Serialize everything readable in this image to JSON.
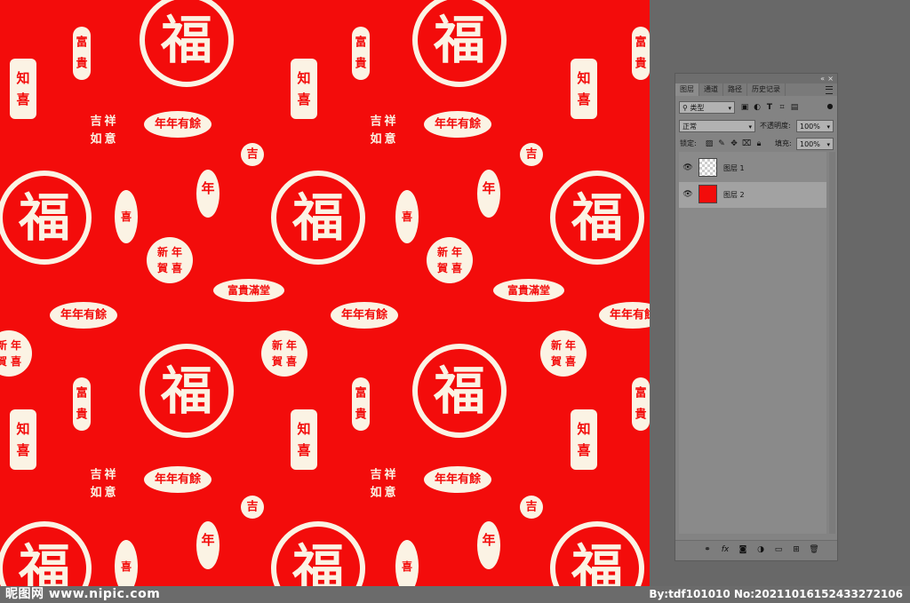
{
  "canvas": {
    "background_color": "#f30c0b",
    "seal_color": "#fbf3e4",
    "seal_texts": {
      "fu": "福",
      "fugui": "富貴",
      "zhixi": "知喜",
      "jixiang": "吉祥如意",
      "niannian": "年年有餘",
      "ji": "吉",
      "nian": "年",
      "xinnian": "新年賀喜",
      "fuguiruyi": "富貴滿堂"
    }
  },
  "layers_panel": {
    "tabs": [
      "图层",
      "通道",
      "路径",
      "历史记录"
    ],
    "filter_label": "类型",
    "blend_mode": "正常",
    "opacity_label": "不透明度:",
    "opacity_value": "100%",
    "lock_label": "锁定:",
    "fill_label": "填充:",
    "fill_value": "100%",
    "layers": [
      {
        "name": "图层 1",
        "thumb": "transparent",
        "selected": false
      },
      {
        "name": "图层 2",
        "thumb": "red",
        "selected": true
      }
    ],
    "icons": {
      "collapse": "«",
      "close": "×"
    }
  },
  "watermark": {
    "left": "昵图网 www.nipic.com",
    "right": "By:tdf101010 No:20211016152433272106"
  }
}
